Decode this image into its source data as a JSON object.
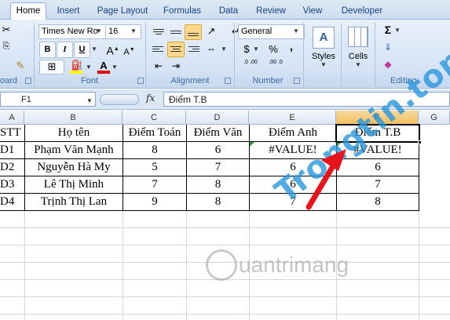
{
  "ribbon": {
    "tabs": [
      "Home",
      "Insert",
      "Page Layout",
      "Formulas",
      "Data",
      "Review",
      "View",
      "Developer"
    ],
    "clipboard_label": "oard",
    "font": {
      "name": "Times New Ro",
      "size": "16",
      "label": "Font",
      "bold": "B",
      "italic": "I",
      "underline": "U",
      "grow": "A",
      "shrink": "A"
    },
    "alignment_label": "Alignment",
    "number": {
      "format": "General",
      "label": "Number",
      "currency": "$",
      "percent": "%",
      "comma": ",",
      "inc_dec": ".0 .00",
      "dec_dec": ".00 .0"
    },
    "styles_label": "Styles",
    "cells_label": "Cells",
    "editing_label": "Editing"
  },
  "formula_bar": {
    "name_box": "F1",
    "fx": "fx",
    "content": "Điểm T.B"
  },
  "grid": {
    "columns": [
      "A",
      "B",
      "C",
      "D",
      "E",
      "F",
      "G"
    ],
    "header_row": [
      "STT",
      "Họ tên",
      "Điểm Toán",
      "Điểm Văn",
      "Điểm Anh",
      "Điểm T.B"
    ],
    "rows": [
      [
        "D1",
        "Phạm Văn Mạnh",
        "8",
        "6",
        "#VALUE!",
        "#VALUE!"
      ],
      [
        "D2",
        "Nguyễn Hà My",
        "5",
        "7",
        "6",
        "6"
      ],
      [
        "D3",
        "Lê Thị Minh",
        "7",
        "8",
        "6",
        "7"
      ],
      [
        "D4",
        "Trịnh Thị Lan",
        "9",
        "8",
        "7",
        "8"
      ]
    ]
  },
  "watermark": {
    "main": "Trongtin.top",
    "secondary": "uantrimang"
  },
  "colors": {
    "arrow": "#e8141c",
    "watermark": "#2896dc",
    "selection_border": "#000000"
  }
}
